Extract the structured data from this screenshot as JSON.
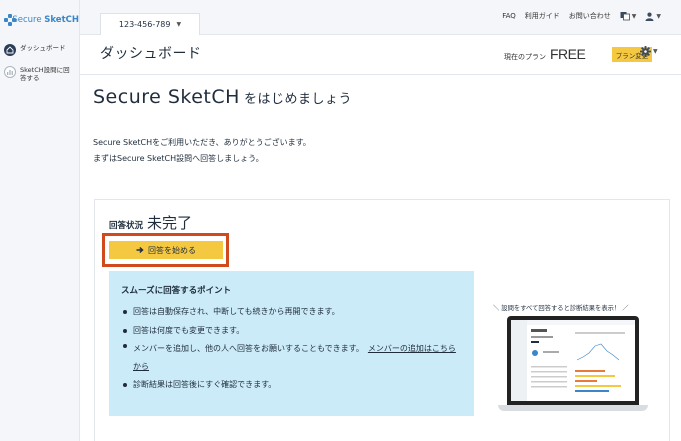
{
  "brand": {
    "prefix": "Secure ",
    "name": "SketCH"
  },
  "sidebar": {
    "items": [
      {
        "label": "ダッシュボード",
        "icon": "home-icon"
      },
      {
        "label": "SketCH設問に回答する",
        "icon": "chart-icon"
      }
    ]
  },
  "topbar": {
    "account_id": "123-456-789",
    "links": {
      "faq": "FAQ",
      "guide": "利用ガイド",
      "contact": "お問い合わせ"
    }
  },
  "header": {
    "title": "ダッシュボード",
    "plan_label": "現在のプラン",
    "plan_value": "FREE",
    "plan_button": "プラン変更"
  },
  "main": {
    "welcome_title": "Secure SketCH",
    "welcome_suffix": "をはじめましょう",
    "intro_line1": "Secure SketCHをご利用いただき、ありがとうございます。",
    "intro_line2": "まずはSecure SketCH設問へ回答しましょう。"
  },
  "card": {
    "status_label": "回答状況",
    "status_value": "未完了",
    "start_button": "回答を始める",
    "points_title": "スムーズに回答するポイント",
    "points": [
      "回答は自動保存され、中断しても続きから再開できます。",
      "回答は何度でも変更できます。",
      "メンバーを追加し、他の人へ回答をお願いすることもできます。",
      "診断結果は回答後にすぐ確認できます。"
    ],
    "member_link": "メンバーの追加はこちらから",
    "preview_caption": "＼ 設問をすべて回答すると診断結果を表示！ ／"
  },
  "colors": {
    "accent_yellow": "#f5c842",
    "highlight_red": "#d04a1e",
    "info_blue": "#ccebf8",
    "brand_blue": "#3a86c8"
  }
}
